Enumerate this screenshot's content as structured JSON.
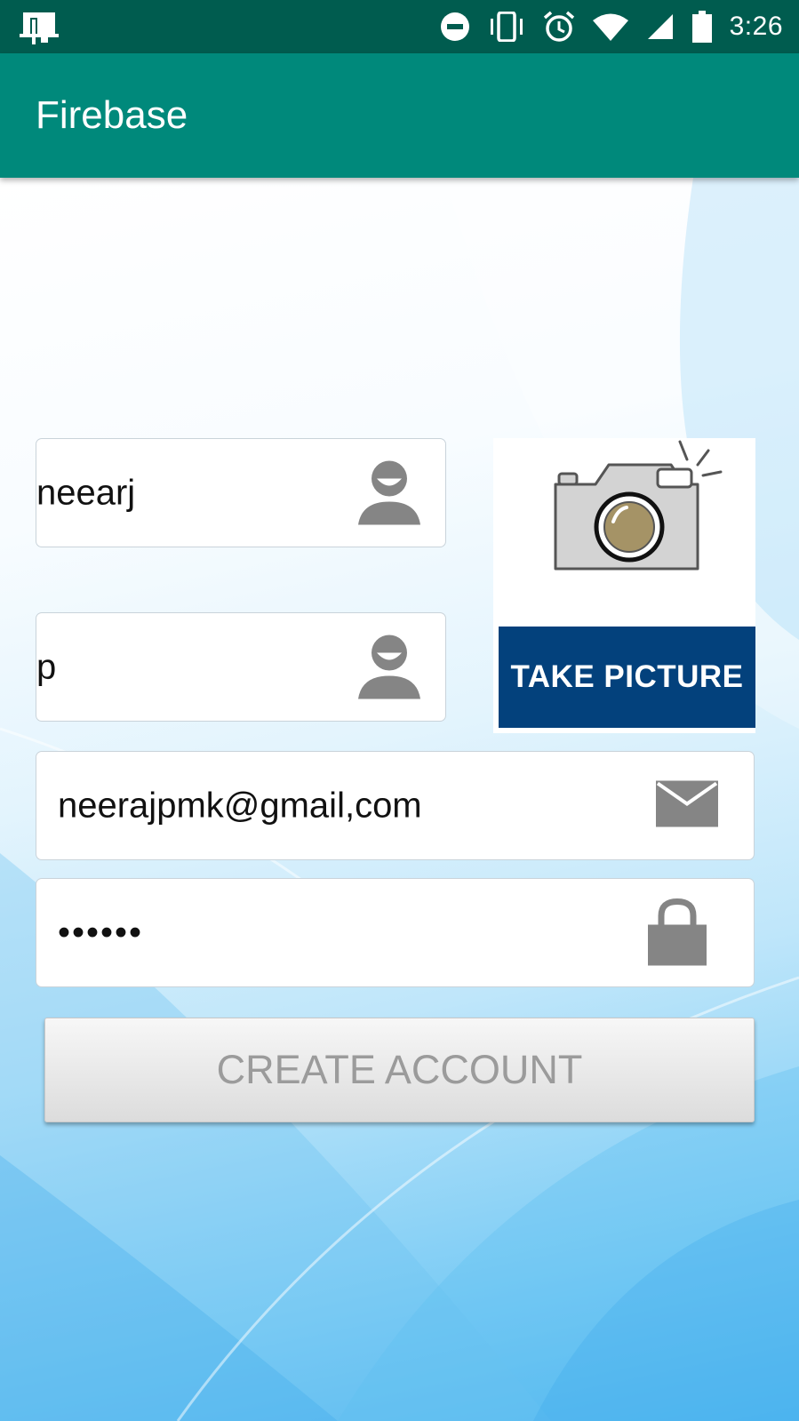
{
  "status_bar": {
    "time": "3:26",
    "icons": [
      "screenshot-icon",
      "do-not-disturb-icon",
      "vibrate-icon",
      "alarm-icon",
      "wifi-icon",
      "cell-signal-icon",
      "battery-icon"
    ]
  },
  "app_bar": {
    "title": "Firebase"
  },
  "form": {
    "first_name": {
      "value": "neearj",
      "icon": "person-icon"
    },
    "last_name": {
      "value": "p",
      "icon": "person-icon"
    },
    "email": {
      "value": "neerajpmk@gmail,com",
      "icon": "mail-icon"
    },
    "password": {
      "value": "••••••",
      "icon": "lock-icon"
    },
    "take_picture_label": "TAKE PICTURE",
    "create_account_label": "CREATE ACCOUNT"
  },
  "colors": {
    "status_bar": "#005c4f",
    "app_bar": "#00897b",
    "take_picture_banner": "#03417c",
    "icon_gray": "#858585",
    "button_text": "#9b9b9b"
  }
}
